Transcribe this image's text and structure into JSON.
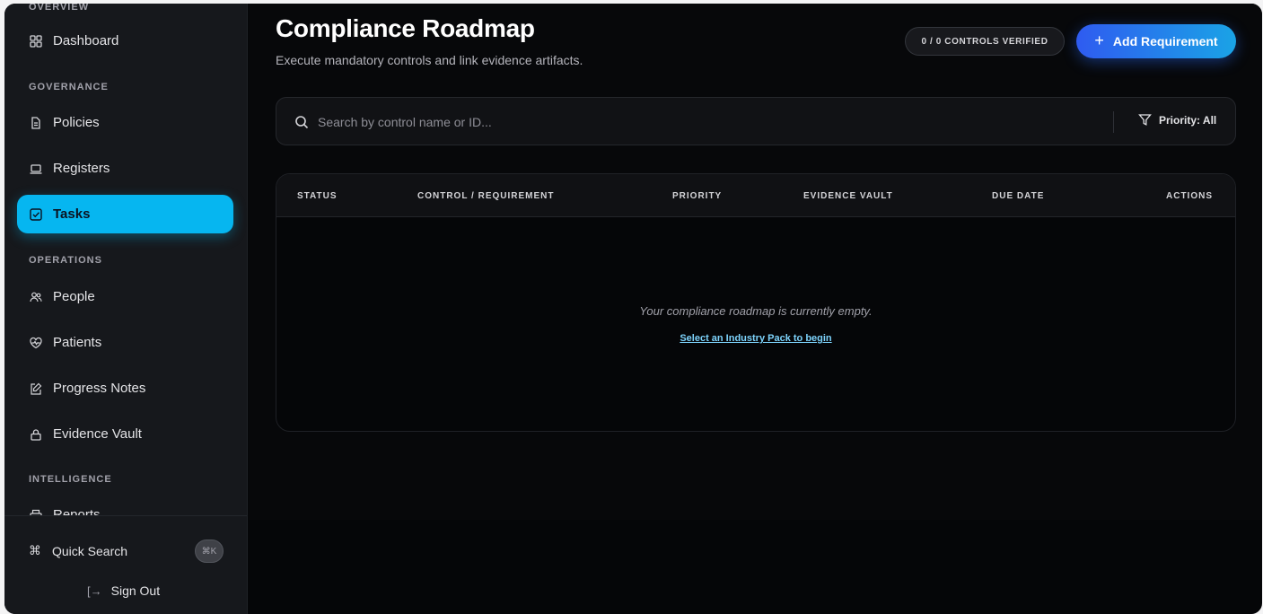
{
  "sidebar": {
    "top_section": "OVERVIEW",
    "sections": {
      "governance": "GOVERNANCE",
      "operations": "OPERATIONS",
      "intelligence": "INTELLIGENCE"
    },
    "items": [
      {
        "label": "Dashboard",
        "icon": "grid-icon"
      },
      {
        "label": "Policies",
        "icon": "document-icon"
      },
      {
        "label": "Registers",
        "icon": "laptop-icon"
      },
      {
        "label": "Tasks",
        "icon": "checkbox-icon",
        "active": true
      },
      {
        "label": "People",
        "icon": "users-icon"
      },
      {
        "label": "Patients",
        "icon": "heart-pulse-icon"
      },
      {
        "label": "Progress Notes",
        "icon": "note-edit-icon"
      },
      {
        "label": "Evidence Vault",
        "icon": "lock-icon"
      },
      {
        "label": "Reports",
        "icon": "printer-icon"
      }
    ],
    "quick_search": {
      "label": "Quick Search",
      "shortcut": "⌘K"
    },
    "sign_out": "Sign Out"
  },
  "header": {
    "title": "Compliance Roadmap",
    "subtitle": "Execute mandatory controls and link evidence artifacts.",
    "verified_badge": "0 / 0 CONTROLS VERIFIED",
    "add_button": "Add Requirement"
  },
  "search": {
    "placeholder": "Search by control name or ID...",
    "value": "",
    "priority_filter": "Priority: All"
  },
  "table": {
    "columns": [
      "STATUS",
      "CONTROL / REQUIREMENT",
      "PRIORITY",
      "EVIDENCE VAULT",
      "DUE DATE",
      "ACTIONS"
    ],
    "rows": [],
    "empty_message": "Your compliance roadmap is currently empty.",
    "empty_link": "Select an Industry Pack to begin"
  },
  "colors": {
    "accent": "#06b6f0",
    "primary_button_start": "#2f5bf0",
    "primary_button_end": "#1aa3e6",
    "background": "#050608",
    "sidebar": "#16181c"
  }
}
